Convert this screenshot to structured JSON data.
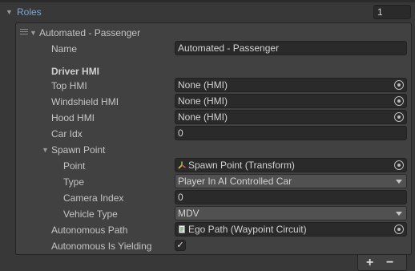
{
  "list": {
    "title": "Roles",
    "count": "1",
    "add_label": "+",
    "remove_label": "−"
  },
  "element": {
    "title": "Automated - Passenger",
    "name_label": "Name",
    "name_value": "Automated - Passenger",
    "driver_hmi_header": "Driver HMI",
    "top_hmi": {
      "label": "Top HMI",
      "value": "None (HMI)"
    },
    "windshield_hmi": {
      "label": "Windshield HMI",
      "value": "None (HMI)"
    },
    "hood_hmi": {
      "label": "Hood HMI",
      "value": "None (HMI)"
    },
    "car_idx": {
      "label": "Car Idx",
      "value": "0"
    },
    "spawn_point": {
      "label": "Spawn Point",
      "point": {
        "label": "Point",
        "value": "Spawn Point (Transform)",
        "icon": "transform-icon"
      },
      "type": {
        "label": "Type",
        "value": "Player In AI Controlled Car"
      },
      "camera_index": {
        "label": "Camera Index",
        "value": "0"
      },
      "vehicle_type": {
        "label": "Vehicle Type",
        "value": "MDV"
      }
    },
    "autonomous_path": {
      "label": "Autonomous Path",
      "value": "Ego Path (Waypoint Circuit)",
      "icon": "script-icon"
    },
    "autonomous_yielding": {
      "label": "Autonomous Is Yielding",
      "checked": true,
      "mark": "✓"
    }
  }
}
